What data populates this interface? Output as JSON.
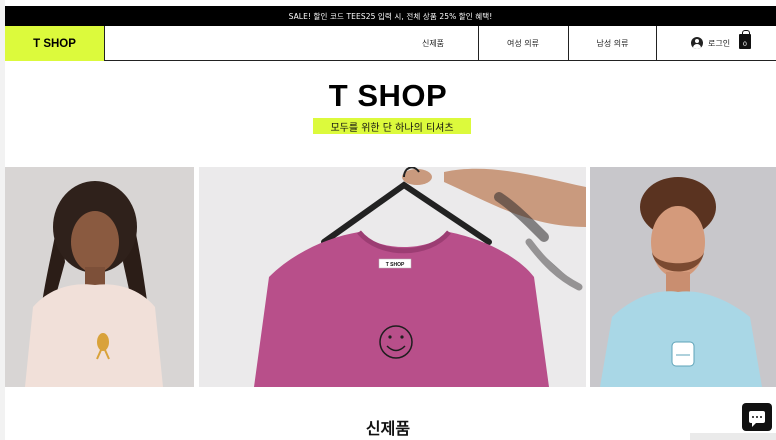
{
  "promo": {
    "text": "SALE! 할인 코드 TEES25 입력 시, 전체 상품 25% 할인 혜택!"
  },
  "header": {
    "logo": "T SHOP",
    "nav": [
      "신제품",
      "여성 의류",
      "남성 의류"
    ],
    "login_label": "로그인",
    "cart_count": "0"
  },
  "hero": {
    "title": "T SHOP",
    "subtitle": "모두를 위한 단 하나의 티셔츠"
  },
  "product_photo": {
    "tag_text": "T SHOP"
  },
  "section": {
    "title": "신제품"
  },
  "colors": {
    "accent": "#dcfa3c",
    "promo_bg": "#000000",
    "shirt_pink": "#b84f8a",
    "shirt_blue": "#a9d7e6",
    "shirt_cream": "#f3e2dc"
  },
  "icons": [
    "user-icon",
    "shopping-bag-icon",
    "chat-icon",
    "smiley-icon"
  ]
}
